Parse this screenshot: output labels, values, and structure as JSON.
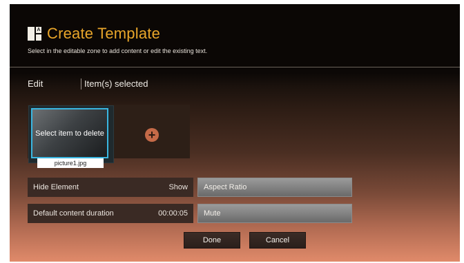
{
  "header": {
    "title": "Create Template",
    "subtitle": "Select in the editable zone to add content or edit the existing text.",
    "icon": "template-layout-icon"
  },
  "toolbar": {
    "edit_label": "Edit",
    "selection_label": "Item(s) selected"
  },
  "zone": {
    "item": {
      "overlay_text": "Select item to delete",
      "caption": "picture1.jpg"
    },
    "add_icon": "plus-circle-icon",
    "add_glyph": "+"
  },
  "settings": {
    "hide_element": {
      "label": "Hide Element",
      "value": "Show"
    },
    "default_duration": {
      "label": "Default content duration",
      "value": "00:00:05"
    },
    "aspect_ratio_label": "Aspect Ratio",
    "mute_label": "Mute"
  },
  "actions": {
    "done_label": "Done",
    "cancel_label": "Cancel"
  },
  "colors": {
    "accent_title": "#e9a62a",
    "selection_border": "#3ab7e2",
    "add_button": "#c56a48"
  }
}
